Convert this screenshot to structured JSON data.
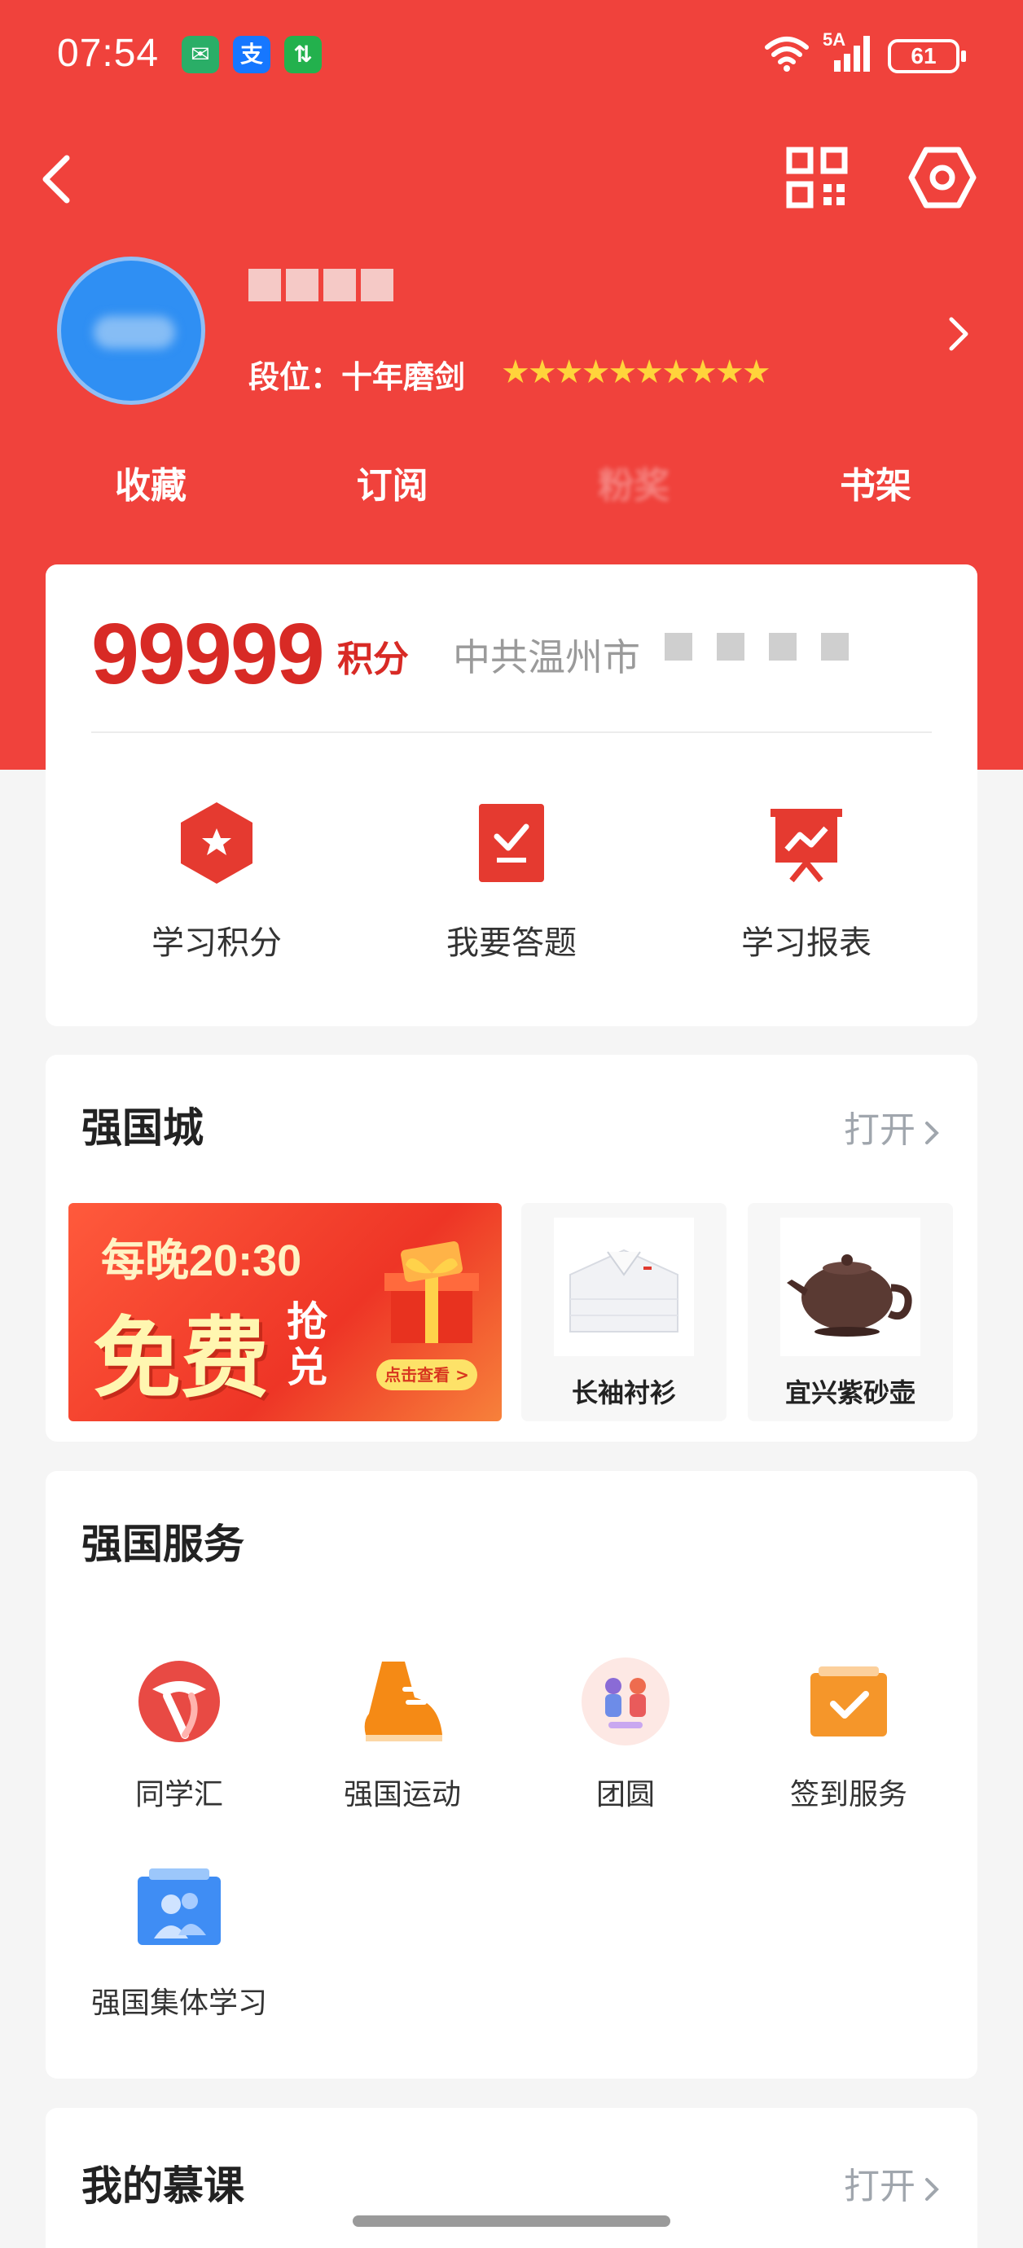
{
  "status_bar": {
    "time": "07:54",
    "apps": [
      "wechat",
      "alipay",
      "green-app"
    ],
    "network": "5A",
    "battery": "61"
  },
  "profile": {
    "rank_label": "段位：十年磨剑",
    "stars": "★★★★★★★★★★",
    "star_count": 10
  },
  "quick_tabs": [
    {
      "label": "收藏"
    },
    {
      "label": "订阅"
    },
    {
      "label": "粉奖"
    },
    {
      "label": "书架"
    }
  ],
  "points": {
    "value": "99999",
    "unit": "积分",
    "org": "中共温州市"
  },
  "shortcuts": [
    {
      "label": "学习积分",
      "icon": "hexagon-star-icon"
    },
    {
      "label": "我要答题",
      "icon": "check-answer-icon"
    },
    {
      "label": "学习报表",
      "icon": "report-board-icon"
    }
  ],
  "mall": {
    "title": "强国城",
    "open_label": "打开",
    "banner": {
      "line1": "每晚20:30",
      "line2": "免费",
      "line3": "抢兑",
      "cta": "点击查看 >"
    },
    "products": [
      {
        "name": "长袖衬衫"
      },
      {
        "name": "宜兴紫砂壶"
      }
    ]
  },
  "services": {
    "title": "强国服务",
    "items": [
      {
        "label": "同学汇",
        "icon": "tongxuehui-icon"
      },
      {
        "label": "强国运动",
        "icon": "sneaker-icon"
      },
      {
        "label": "团圆",
        "icon": "reunion-icon"
      },
      {
        "label": "签到服务",
        "icon": "check-in-icon"
      },
      {
        "label": "强国集体学习",
        "icon": "group-study-icon"
      }
    ]
  },
  "mooc": {
    "title": "我的慕课",
    "open_label": "打开"
  },
  "colors": {
    "brand_red": "#f0423c",
    "points_red": "#d82a25",
    "star_yellow": "#ffd43b"
  }
}
